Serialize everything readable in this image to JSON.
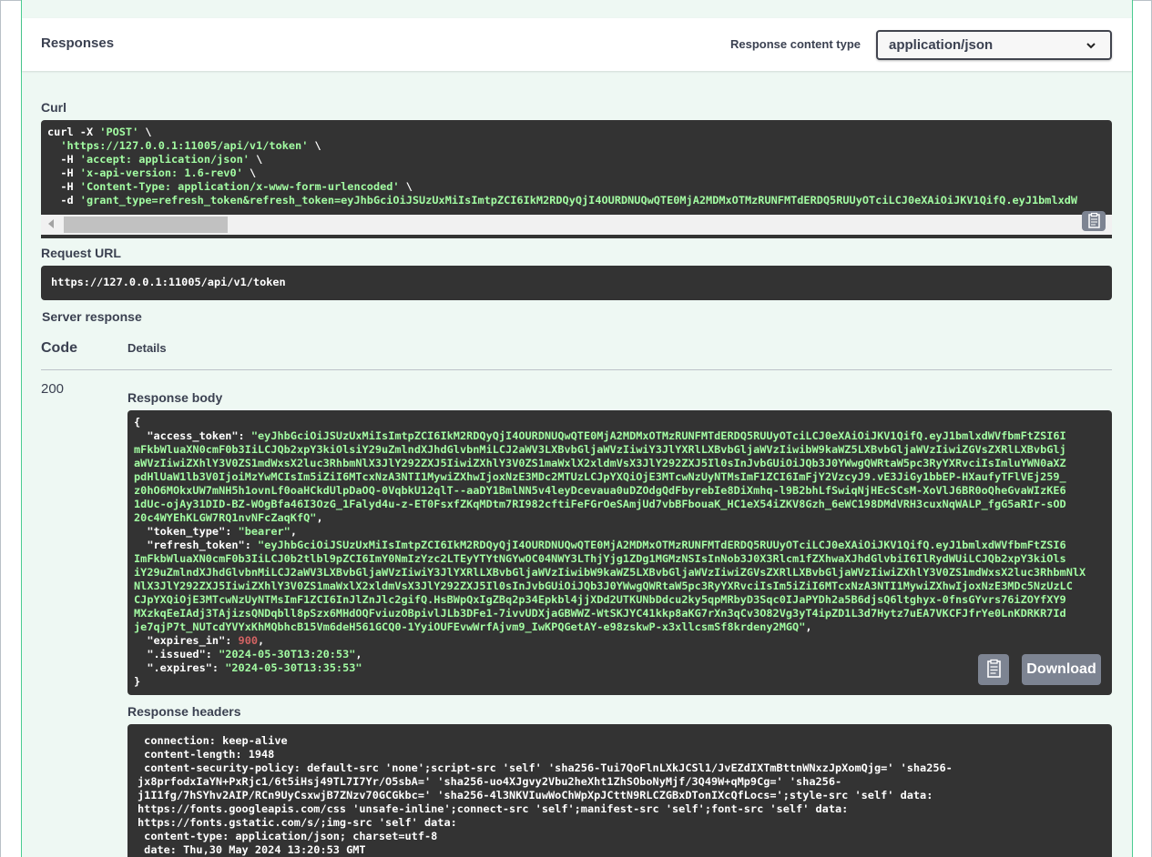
{
  "responses": {
    "title": "Responses",
    "content_type_label": "Response content type",
    "content_type_value": "application/json"
  },
  "curl": {
    "label": "Curl",
    "lines": [
      {
        "pre": "curl -X ",
        "str": "'POST'",
        "post": " \\"
      },
      {
        "pre": "  ",
        "str": "'https://127.0.0.1:11005/api/v1/token'",
        "post": " \\"
      },
      {
        "pre": "  -H ",
        "str": "'accept: application/json'",
        "post": " \\"
      },
      {
        "pre": "  -H ",
        "str": "'x-api-version: 1.6-rev0'",
        "post": " \\"
      },
      {
        "pre": "  -H ",
        "str": "'Content-Type: application/x-www-form-urlencoded'",
        "post": " \\"
      },
      {
        "pre": "  -d ",
        "str": "'grant_type=refresh_token&refresh_token=eyJhbGciOiJSUzUxMiIsImtpZCI6IkM2RDQyQjI4OURDNUQwQTE0MjA2MDMxOTMzRUNFMTdERDQ5RUUyOTciLCJ0eXAiOiJKV1QifQ.eyJ1bmlxdW",
        "post": ""
      }
    ]
  },
  "request_url": {
    "label": "Request URL",
    "value": "https://127.0.0.1:11005/api/v1/token"
  },
  "server_response": {
    "label": "Server response",
    "code_header": "Code",
    "details_header": "Details",
    "code": "200"
  },
  "response_body": {
    "label": "Response body",
    "lines": [
      [
        {
          "t": "{",
          "c": "wht"
        }
      ],
      [
        {
          "t": "  \"access_token\": ",
          "c": "wht"
        },
        {
          "t": "\"eyJhbGciOiJSUzUxMiIsImtpZCI6IkM2RDQyQjI4OURDNUQwQTE0MjA2MDMxOTMzRUNFMTdERDQ5RUUyOTciLCJ0eXAiOiJKV1QifQ.eyJ1bmlxdWVfbmFtZSI6I",
          "c": "str"
        }
      ],
      [
        {
          "t": "mFkbWluaXN0cmF0b3IiLCJQb2xpY3kiOlsiY29uZmlndXJhdGlvbnMiLCJ2aWV3LXBvbGljaWVzIiwiY3JlYXRlLXBvbGljaWVzIiwibW9kaWZ5LXBvbGljaWVzIiwiZGVsZXRlLXBvbGlj",
          "c": "str"
        }
      ],
      [
        {
          "t": "aWVzIiwiZXhlY3V0ZS1mdWxsX2luc3RhbmNlX3JlY292ZXJ5IiwiZXhlY3V0ZS1maWxlX2xldmVsX3JlY292ZXJ5Il0sInJvbGUiOiJQb3J0YWwgQWRtaW5pc3RyYXRvciIsImluYWN0aXZ",
          "c": "str"
        }
      ],
      [
        {
          "t": "pdHlUaW1lb3V0IjoiMzYwMCIsIm5iZiI6MTcxNzA3NTI1MywiZXhwIjoxNzE3MDc2MTUzLCJpYXQiOjE3MTcwNzUyNTMsImF1ZCI6ImFjY2VzcyJ9.vE3JiGy1bbEP-HXaufyTFlVEj259_",
          "c": "str"
        }
      ],
      [
        {
          "t": "z0hO6MOkxUW7mNH5h1ovnLf0oaHCkdUlpDaOQ-0VqbkU12qlT--aaDY1BmlNN5v4leyDcevaua0uDZOdgQdFbyrebIe8DiXmhq-l9B2bhLfSwiqNjHEcSCsM-XoVlJ6BR0oQheGvaWIzKE6",
          "c": "str"
        }
      ],
      [
        {
          "t": "1dUc-ojAy31DID-BZ-WOgBfa46I3OzG_1Falyd4u-z-ET0FsxfZKqMDtm7RI982cftiFeFGrOeSAmjUd7vbBFbouaK_HC1eX54iZKV8Gzh_6eWC198DMdVRH3cuxNqWALP_fgG5aRIr-sOD",
          "c": "str"
        }
      ],
      [
        {
          "t": "20c4WYEhKLGW7RQ1nvNFcZaqKfQ\"",
          "c": "str"
        },
        {
          "t": ",",
          "c": "wht"
        }
      ],
      [
        {
          "t": "  \"token_type\": ",
          "c": "wht"
        },
        {
          "t": "\"bearer\"",
          "c": "str"
        },
        {
          "t": ",",
          "c": "wht"
        }
      ],
      [
        {
          "t": "  \"refresh_token\": ",
          "c": "wht"
        },
        {
          "t": "\"eyJhbGciOiJSUzUxMiIsImtpZCI6IkM2RDQyQjI4OURDNUQwQTE0MjA2MDMxOTMzRUNFMTdERDQ5RUUyOTciLCJ0eXAiOiJKV1QifQ.eyJ1bmlxdWVfbmFtZSI6",
          "c": "str"
        }
      ],
      [
        {
          "t": "ImFkbWluaXN0cmF0b3IiLCJ0b2tlbl9pZCI6ImY0NmIzYzc2LTEyYTYtNGYwOC04NWY3LThjYjg1ZDg1MGMzNSIsInNob3J0X3Rlcm1fZXhwaXJhdGlvbiI6IlRydWUiLCJQb2xpY3kiOls",
          "c": "str"
        }
      ],
      [
        {
          "t": "iY29uZmlndXJhdGlvbnMiLCJ2aWV3LXBvbGljaWVzIiwiY3JlYXRlLXBvbGljaWVzIiwibW9kaWZ5LXBvbGljaWVzIiwiZGVsZXRlLXBvbGljaWVzIiwiZXhlY3V0ZS1mdWxsX2luc3RhbmNlX",
          "c": "str"
        }
      ],
      [
        {
          "t": "NlX3JlY292ZXJ5IiwiZXhlY3V0ZS1maWxlX2xldmVsX3JlY292ZXJ5Il0sInJvbGUiOiJQb3J0YWwgQWRtaW5pc3RyYXRvciIsIm5iZiI6MTcxNzA3NTI1MywiZXhwIjoxNzE3MDc5NzUzLC",
          "c": "str"
        }
      ],
      [
        {
          "t": "CJpYXQiOjE3MTcwNzUyNTMsImF1ZCI6InJlZnJlc2gifQ.HsBWpQxIgZBq2p34Epkbl4jjXDd2UTKUNbDdcu2ky5qpMRbyD3Sqc0IJaPYDh2a5B6djsQ6ltghyx-0fnsGYvrs76iZOYfXY9",
          "c": "str"
        }
      ],
      [
        {
          "t": "MXzkqEeIAdj3TAjizsQNDqbll8pSzx6MHdOQFviuzOBpivlJLb3DFe1-7ivvUDXjaGBWWZ-WtSKJYC41kkp8aKG7rXn3qCv3O82Vg3yT4ipZD1L3d7Hytz7uEA7VKCFJfrYe0LnKDRKR7Id",
          "c": "str"
        }
      ],
      [
        {
          "t": "je7qjP7t_NUTcdYVYxKhMQbhcB15Vm6deH561GCQ0-1YyiOUFEvwWrfAjvm9_IwKPQGetAY-e98zskwP-x3xllcsmSf8krdeny2MGQ\"",
          "c": "str"
        },
        {
          "t": ",",
          "c": "wht"
        }
      ],
      [
        {
          "t": "  \"expires_in\": ",
          "c": "wht"
        },
        {
          "t": "900",
          "c": "num"
        },
        {
          "t": ",",
          "c": "wht"
        }
      ],
      [
        {
          "t": "  \".issued\": ",
          "c": "wht"
        },
        {
          "t": "\"2024-05-30T13:20:53\"",
          "c": "str"
        },
        {
          "t": ",",
          "c": "wht"
        }
      ],
      [
        {
          "t": "  \".expires\": ",
          "c": "wht"
        },
        {
          "t": "\"2024-05-30T13:35:53\"",
          "c": "str"
        }
      ],
      [
        {
          "t": "}",
          "c": "wht"
        }
      ]
    ],
    "download_label": "Download"
  },
  "response_headers": {
    "label": "Response headers",
    "lines": [
      " connection: keep-alive",
      " content-length: 1948",
      " content-security-policy: default-src 'none';script-src 'self' 'sha256-Tui7QoFlnLXkJCSl1/JvEZdIXTmBttnWNxzJpXomQjg=' 'sha256-",
      "jx8prfodxIaYN+PxRjc1/6t5iHsj49TL7I7Yr/O5sbA=' 'sha256-uo4XJgvy2Vbu2heXht1ZhSOboNyMjf/3Q49W+qMp9Cg=' 'sha256-",
      "j1I1fg/7hSYhv2AIP/RCn9UyCsxwjB7ZNzv70GCGkbc=' 'sha256-4l3NKVIuwWoChWpXpJCttN9RLCZGBxDTonIXcQfLocs=';style-src 'self' data:",
      "https://fonts.googleapis.com/css 'unsafe-inline';connect-src 'self';manifest-src 'self';font-src 'self' data:",
      "https://fonts.gstatic.com/s/;img-src 'self' data:",
      " content-type: application/json; charset=utf-8",
      " date: Thu,30 May 2024 13:20:53 GMT"
    ]
  },
  "icons": {
    "copy": "clipboard-icon",
    "dropdown": "chevron-down-icon"
  }
}
